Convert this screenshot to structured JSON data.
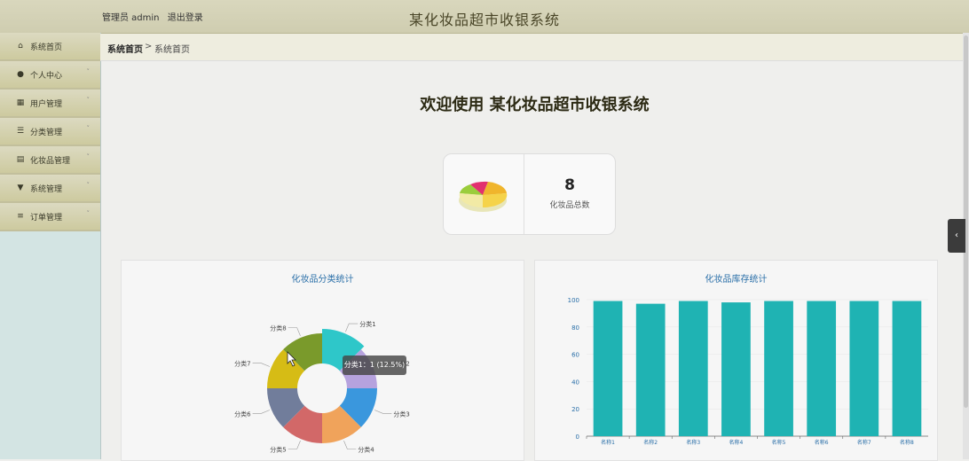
{
  "header": {
    "user_label": "管理员 admin",
    "logout_label": "退出登录",
    "title": "某化妆品超市收银系统"
  },
  "sidebar": {
    "items": [
      {
        "label": "系统首页",
        "icon": "home-icon",
        "glyph": "⌂"
      },
      {
        "label": "个人中心",
        "icon": "user-icon",
        "glyph": "●"
      },
      {
        "label": "用户管理",
        "icon": "grid-icon",
        "glyph": "▦"
      },
      {
        "label": "分类管理",
        "icon": "sliders-icon",
        "glyph": "☰"
      },
      {
        "label": "化妆品管理",
        "icon": "clipboard-icon",
        "glyph": "▤"
      },
      {
        "label": "系统管理",
        "icon": "funnel-icon",
        "glyph": "▼"
      },
      {
        "label": "订单管理",
        "icon": "list-icon",
        "glyph": "≡"
      }
    ],
    "chevron": "˅"
  },
  "breadcrumb": {
    "home": "系统首页",
    "separator": ">",
    "current": "系统首页"
  },
  "welcome": "欢迎使用 某化妆品超市收银系统",
  "stat": {
    "value": "8",
    "label": "化妆品总数"
  },
  "pie": {
    "title": "化妆品分类统计",
    "tooltip": "分类1：1 (12.5%)"
  },
  "bar": {
    "title": "化妆品库存统计"
  },
  "colors": {
    "accent": "#2a6fa8",
    "bar": "#1fb3b3"
  },
  "chart_data": [
    {
      "type": "pie",
      "title": "化妆品分类统计",
      "categories": [
        "分类1",
        "分类2",
        "分类3",
        "分类4",
        "分类5",
        "分类6",
        "分类7",
        "分类8"
      ],
      "values": [
        1,
        1,
        1,
        1,
        1,
        1,
        1,
        1
      ],
      "colors": [
        "#2ec7c9",
        "#b6a2de",
        "#3a97dd",
        "#f0a35b",
        "#d26868",
        "#717d9b",
        "#d6bc15",
        "#7a9a2b"
      ]
    },
    {
      "type": "bar",
      "title": "化妆品库存统计",
      "categories": [
        "名称1",
        "名称2",
        "名称3",
        "名称4",
        "名称5",
        "名称6",
        "名称7",
        "名称8"
      ],
      "values": [
        99,
        97,
        99,
        98,
        99,
        99,
        99,
        99
      ],
      "ylim": [
        0,
        100
      ],
      "yticks": [
        0,
        20,
        40,
        60,
        80,
        100
      ]
    }
  ]
}
